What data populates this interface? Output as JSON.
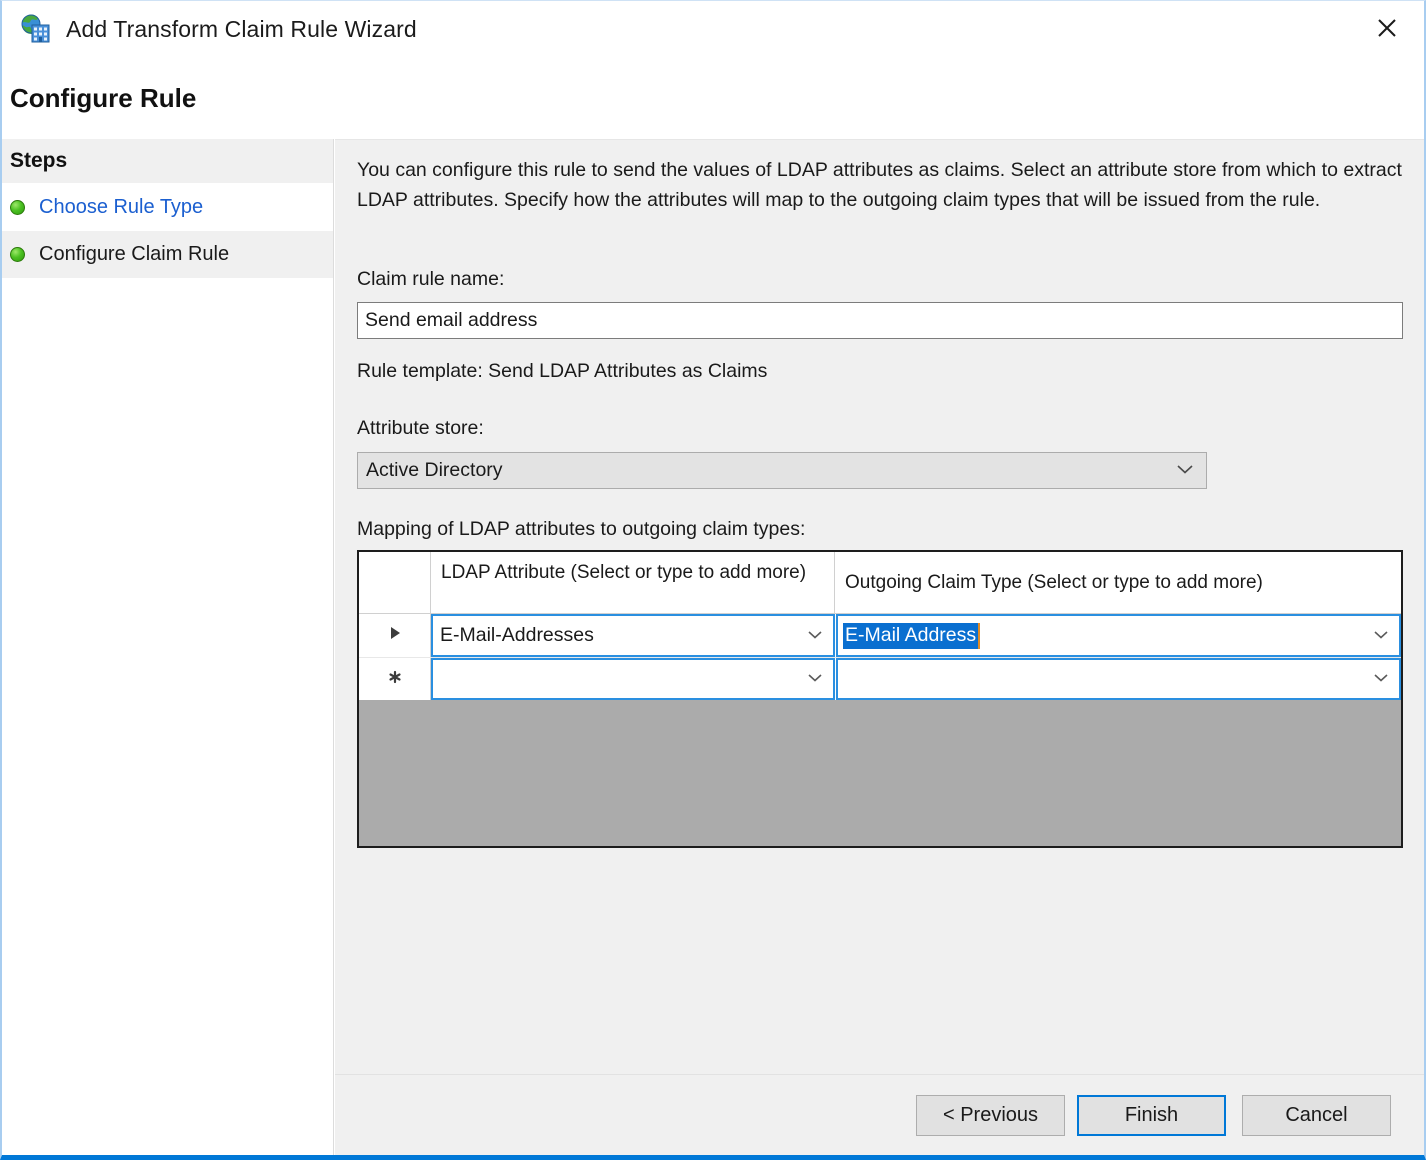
{
  "window": {
    "title": "Add Transform Claim Rule Wizard",
    "icon": "claim-rule-wizard-icon",
    "close_icon": "close-icon",
    "accent_color": "#0078d7",
    "border_color": "#a8cdf0"
  },
  "page": {
    "heading": "Configure Rule"
  },
  "sidebar": {
    "header": "Steps",
    "items": [
      {
        "label": "Choose Rule Type",
        "bullet": "completed-step-icon",
        "state": "link"
      },
      {
        "label": "Configure Claim Rule",
        "bullet": "completed-step-icon",
        "state": "current"
      }
    ]
  },
  "main": {
    "intro": "You can configure this rule to send the values of LDAP attributes as claims. Select an attribute store from which to extract LDAP attributes. Specify how the attributes will map to the outgoing claim types that will be issued from the rule.",
    "rule_name_label": "Claim rule name:",
    "rule_name_value": "Send email address",
    "rule_name_placeholder": "",
    "rule_template_text": "Rule template: Send LDAP Attributes as Claims",
    "attribute_store_label": "Attribute store:",
    "attribute_store_value": "Active Directory",
    "attribute_store_options": [
      "Active Directory"
    ],
    "mapping_label": "Mapping of LDAP attributes to outgoing claim types:",
    "grid": {
      "columns": [
        "LDAP Attribute (Select or type to add more)",
        "Outgoing Claim Type (Select or type to add more)"
      ],
      "rows": [
        {
          "marker": "current-row-arrow-icon",
          "marker_glyph": "▶",
          "ldap_attribute": "E-Mail-Addresses",
          "outgoing_claim_type": "E-Mail Address",
          "claim_type_selected": true
        },
        {
          "marker": "new-row-asterisk-icon",
          "marker_glyph": "✻",
          "ldap_attribute": "",
          "outgoing_claim_type": "",
          "claim_type_selected": false
        }
      ],
      "empty_area_color": "#ababab",
      "cell_focus_color": "#2a8fe0",
      "selection_color": "#0a6fd0",
      "caret_color": "#e08b26"
    }
  },
  "footer": {
    "previous_label": "< Previous",
    "finish_label": "Finish",
    "cancel_label": "Cancel",
    "default_button": "Finish"
  }
}
